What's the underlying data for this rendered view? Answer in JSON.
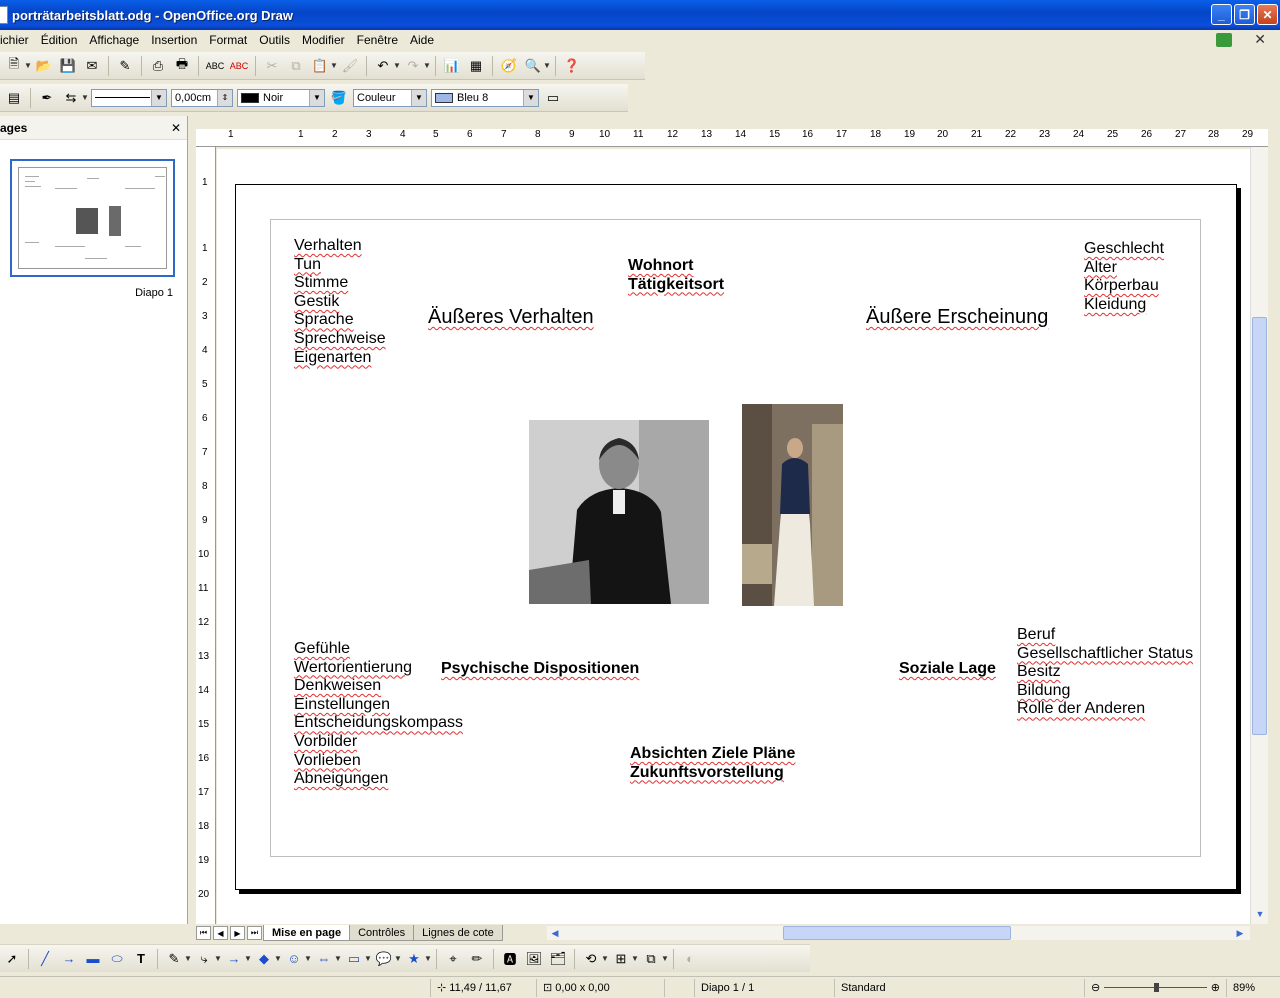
{
  "window": {
    "title": "porträtarbeitsblatt.odg - OpenOffice.org Draw",
    "minimize": "_",
    "maximize": "❐",
    "close": "✕"
  },
  "menu": [
    "ichier",
    "Édition",
    "Affichage",
    "Insertion",
    "Format",
    "Outils",
    "Modifier",
    "Fenêtre",
    "Aide"
  ],
  "line_toolbar": {
    "line_width": "0,00cm",
    "line_color": "Noir",
    "area_style": "Couleur",
    "area_color": "Bleu 8",
    "colors": {
      "line_color": "#000000",
      "area_color": "#9DB8E8"
    }
  },
  "pages_panel": {
    "title": "ages",
    "close": "✕",
    "slide_label": "Diapo 1"
  },
  "ruler": {
    "h_ticks": [
      "1",
      "1",
      "2",
      "3",
      "4",
      "5",
      "6",
      "7",
      "8",
      "9",
      "10",
      "11",
      "12",
      "13",
      "14",
      "15",
      "16",
      "17",
      "18",
      "19",
      "20",
      "21",
      "22",
      "23",
      "24",
      "25",
      "26",
      "27",
      "28",
      "29"
    ],
    "v_ticks": [
      "1",
      "1",
      "2",
      "3",
      "4",
      "5",
      "6",
      "7",
      "8",
      "9",
      "10",
      "11",
      "12",
      "13",
      "14",
      "15",
      "16",
      "17",
      "18",
      "19",
      "20"
    ]
  },
  "slide": {
    "verhalten_list": [
      "Verhalten",
      "Tun",
      "Stimme",
      "Gestik",
      "Sprache",
      "Sprechweise",
      "Eigenarten"
    ],
    "wohnort": [
      "Wohnort",
      "Tätigkeitsort"
    ],
    "erscheinung_list": [
      "Geschlecht",
      "Alter",
      "Körperbau",
      "Kleidung"
    ],
    "heading_verhalten": "Äußeres Verhalten",
    "heading_erscheinung": "Äußere Erscheinung",
    "gefuehle_list": [
      "Gefühle",
      "Wertorientierung",
      "Denkweisen",
      "Einstellungen",
      "Entscheidungskompass",
      "Vorbilder",
      "Vorlieben",
      "Abneigungen"
    ],
    "heading_psych": "Psychische Dispositionen",
    "heading_sozial": "Soziale Lage",
    "sozial_list": [
      "Beruf",
      "Gesellschaftlicher Status",
      "Besitz",
      "Bildung",
      "Rolle der Anderen"
    ],
    "absichten": [
      "Absichten Ziele Pläne",
      "Zukunftsvorstellung"
    ]
  },
  "tabs": [
    "Mise en page",
    "Contrôles",
    "Lignes de cote"
  ],
  "status": {
    "position": "11,49 / 11,67",
    "size": "0,00 x 0,00",
    "slide": "Diapo 1 / 1",
    "layout": "Standard",
    "zoom": "89%"
  }
}
